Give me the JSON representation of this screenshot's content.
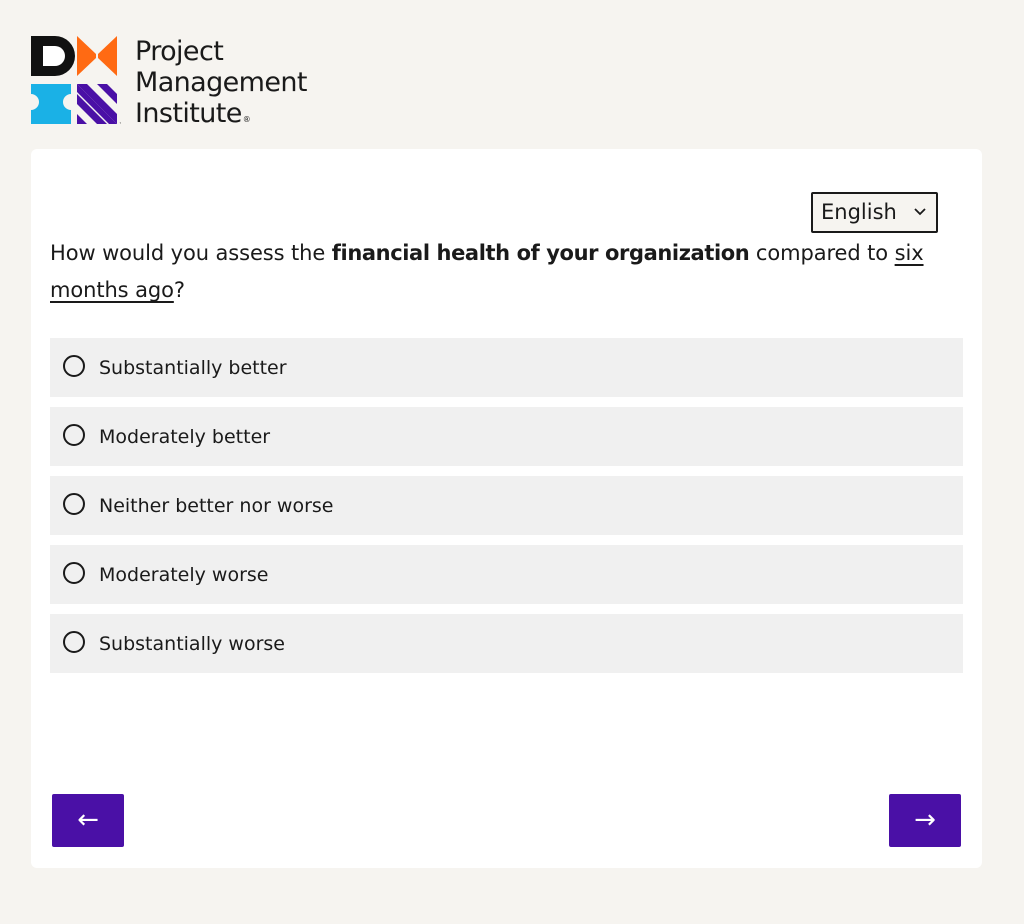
{
  "brand": {
    "line1": "Project",
    "line2": "Management",
    "line3": "Institute",
    "tm": "™",
    "reg": "®",
    "colors": {
      "black": "#111111",
      "orange": "#ff6a13",
      "cyan": "#1ab1e6",
      "purple": "#4a10a6"
    }
  },
  "language": {
    "selected": "English",
    "icon": "chevron-down-icon"
  },
  "question": {
    "prefix": "How would you assess the ",
    "emphasis": "financial health of your organization",
    "middle": " compared to ",
    "underlined": "six months ago",
    "suffix": "?"
  },
  "options": [
    {
      "label": "Substantially better"
    },
    {
      "label": "Moderately better"
    },
    {
      "label": "Neither better nor worse"
    },
    {
      "label": "Moderately worse"
    },
    {
      "label": "Substantially worse"
    }
  ],
  "navigation": {
    "back_label": "←",
    "next_label": "→",
    "accent": "#4a10a6"
  }
}
